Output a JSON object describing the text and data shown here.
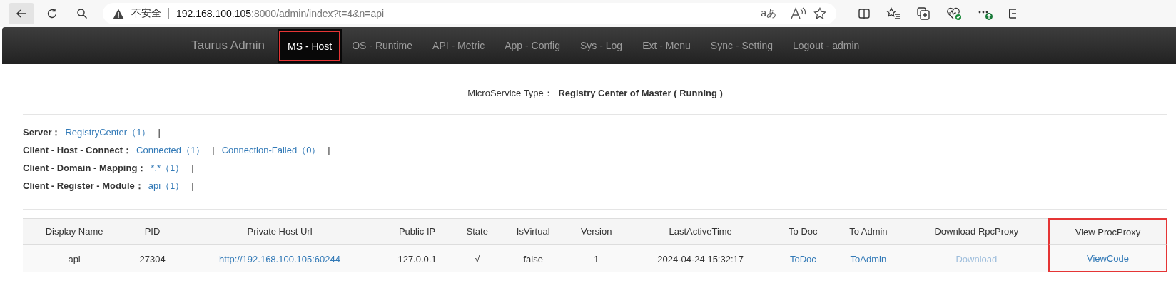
{
  "browser": {
    "security_label": "不安全",
    "url_host": "192.168.100.105",
    "url_rest": ":8000/admin/index?t=4&n=api",
    "translate_glyph": "aあ"
  },
  "navbar": {
    "brand": "Taurus Admin",
    "items": [
      {
        "label": "MS - Host",
        "selected": true,
        "highlighted": true
      },
      {
        "label": "OS - Runtime",
        "selected": false,
        "highlighted": false
      },
      {
        "label": "API - Metric",
        "selected": false,
        "highlighted": false
      },
      {
        "label": "App - Config",
        "selected": false,
        "highlighted": false
      },
      {
        "label": "Sys - Log",
        "selected": false,
        "highlighted": false
      },
      {
        "label": "Ext - Menu",
        "selected": false,
        "highlighted": false
      },
      {
        "label": "Sync - Setting",
        "selected": false,
        "highlighted": false
      },
      {
        "label": "Logout - admin",
        "selected": false,
        "highlighted": false
      }
    ]
  },
  "service_type": {
    "label": "MicroService Type：",
    "value": "Registry Center of Master ( Running )"
  },
  "summary": [
    {
      "label": "Server：",
      "links": [
        {
          "text": "RegistryCenter（1）",
          "separator": "|"
        }
      ]
    },
    {
      "label": "Client - Host - Connect：",
      "links": [
        {
          "text": "Connected（1）",
          "separator": "|"
        },
        {
          "text": "Connection-Failed（0）",
          "separator": "|"
        }
      ]
    },
    {
      "label": "Client - Domain - Mapping：",
      "links": [
        {
          "text": "*.*（1）",
          "separator": "|"
        }
      ]
    },
    {
      "label": "Client - Register - Module：",
      "links": [
        {
          "text": "api（1）",
          "separator": "|"
        }
      ]
    }
  ],
  "table": {
    "columns": [
      {
        "label": "Display Name",
        "highlighted": false
      },
      {
        "label": "PID",
        "highlighted": false
      },
      {
        "label": "Private Host Url",
        "highlighted": false
      },
      {
        "label": "Public IP",
        "highlighted": false
      },
      {
        "label": "State",
        "highlighted": false
      },
      {
        "label": "IsVirtual",
        "highlighted": false
      },
      {
        "label": "Version",
        "highlighted": false
      },
      {
        "label": "LastActiveTime",
        "highlighted": false
      },
      {
        "label": "To Doc",
        "highlighted": false
      },
      {
        "label": "To Admin",
        "highlighted": false
      },
      {
        "label": "Download RpcProxy",
        "highlighted": false
      },
      {
        "label": "View ProcProxy",
        "highlighted": true
      }
    ],
    "rows": [
      [
        {
          "kind": "text",
          "text": "api"
        },
        {
          "kind": "text",
          "text": "27304"
        },
        {
          "kind": "link",
          "text": "http://192.168.100.105:60244",
          "disabled": false
        },
        {
          "kind": "text",
          "text": "127.0.0.1"
        },
        {
          "kind": "text",
          "text": "√"
        },
        {
          "kind": "text",
          "text": "false"
        },
        {
          "kind": "text",
          "text": "1"
        },
        {
          "kind": "text",
          "text": "2024-04-24 15:32:17"
        },
        {
          "kind": "link",
          "text": "ToDoc",
          "disabled": false
        },
        {
          "kind": "link",
          "text": "ToAdmin",
          "disabled": false
        },
        {
          "kind": "link",
          "text": "Download",
          "disabled": true
        },
        {
          "kind": "link",
          "text": "ViewCode",
          "disabled": false
        }
      ]
    ]
  }
}
